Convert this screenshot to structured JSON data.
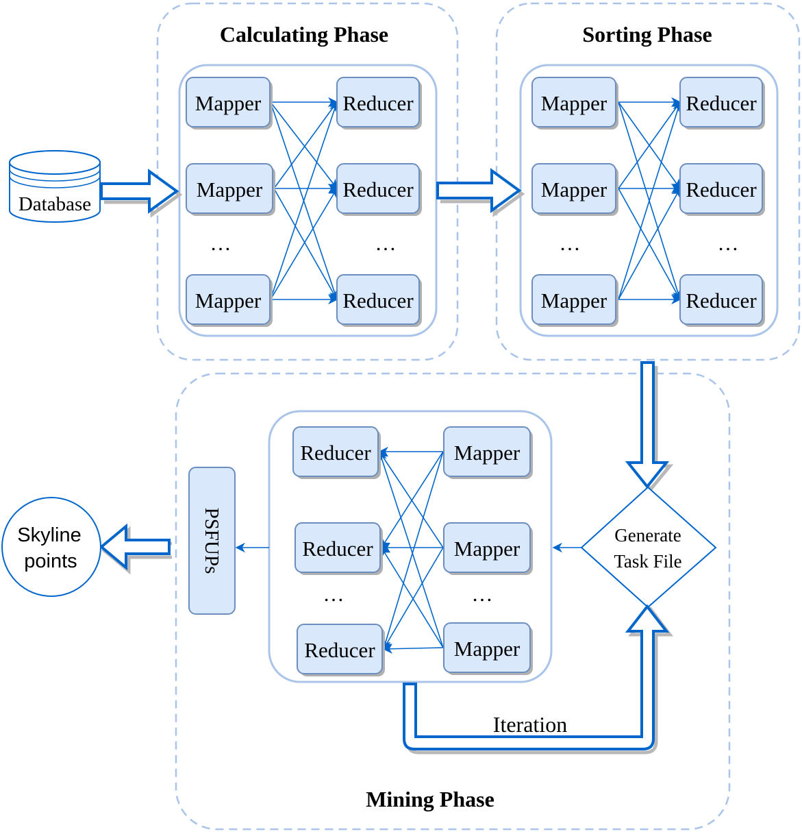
{
  "phases": {
    "calculating": {
      "title": "Calculating Phase",
      "mappers": [
        "Mapper",
        "Mapper",
        "Mapper"
      ],
      "reducers": [
        "Reducer",
        "Reducer",
        "Reducer"
      ],
      "ellipsis_left": "…",
      "ellipsis_right": "…"
    },
    "sorting": {
      "title": "Sorting Phase",
      "mappers": [
        "Mapper",
        "Mapper",
        "Mapper"
      ],
      "reducers": [
        "Reducer",
        "Reducer",
        "Reducer"
      ],
      "ellipsis_left": "…",
      "ellipsis_right": "…"
    },
    "mining": {
      "title": "Mining Phase",
      "reducers": [
        "Reducer",
        "Reducer",
        "Reducer"
      ],
      "mappers": [
        "Mapper",
        "Mapper",
        "Mapper"
      ],
      "ellipsis_left": "…",
      "ellipsis_right": "…"
    }
  },
  "nodes": {
    "database": "Database",
    "generate_task_file_line1": "Generate",
    "generate_task_file_line2": "Task File",
    "psfups": "PSFUPs",
    "skyline_line1": "Skyline",
    "skyline_line2": "points",
    "iteration": "Iteration"
  },
  "colors": {
    "accent": "#0066cc",
    "node_fill": "#dae8fc",
    "node_stroke": "#6c8ebf",
    "frame": "#a9c4e8"
  }
}
